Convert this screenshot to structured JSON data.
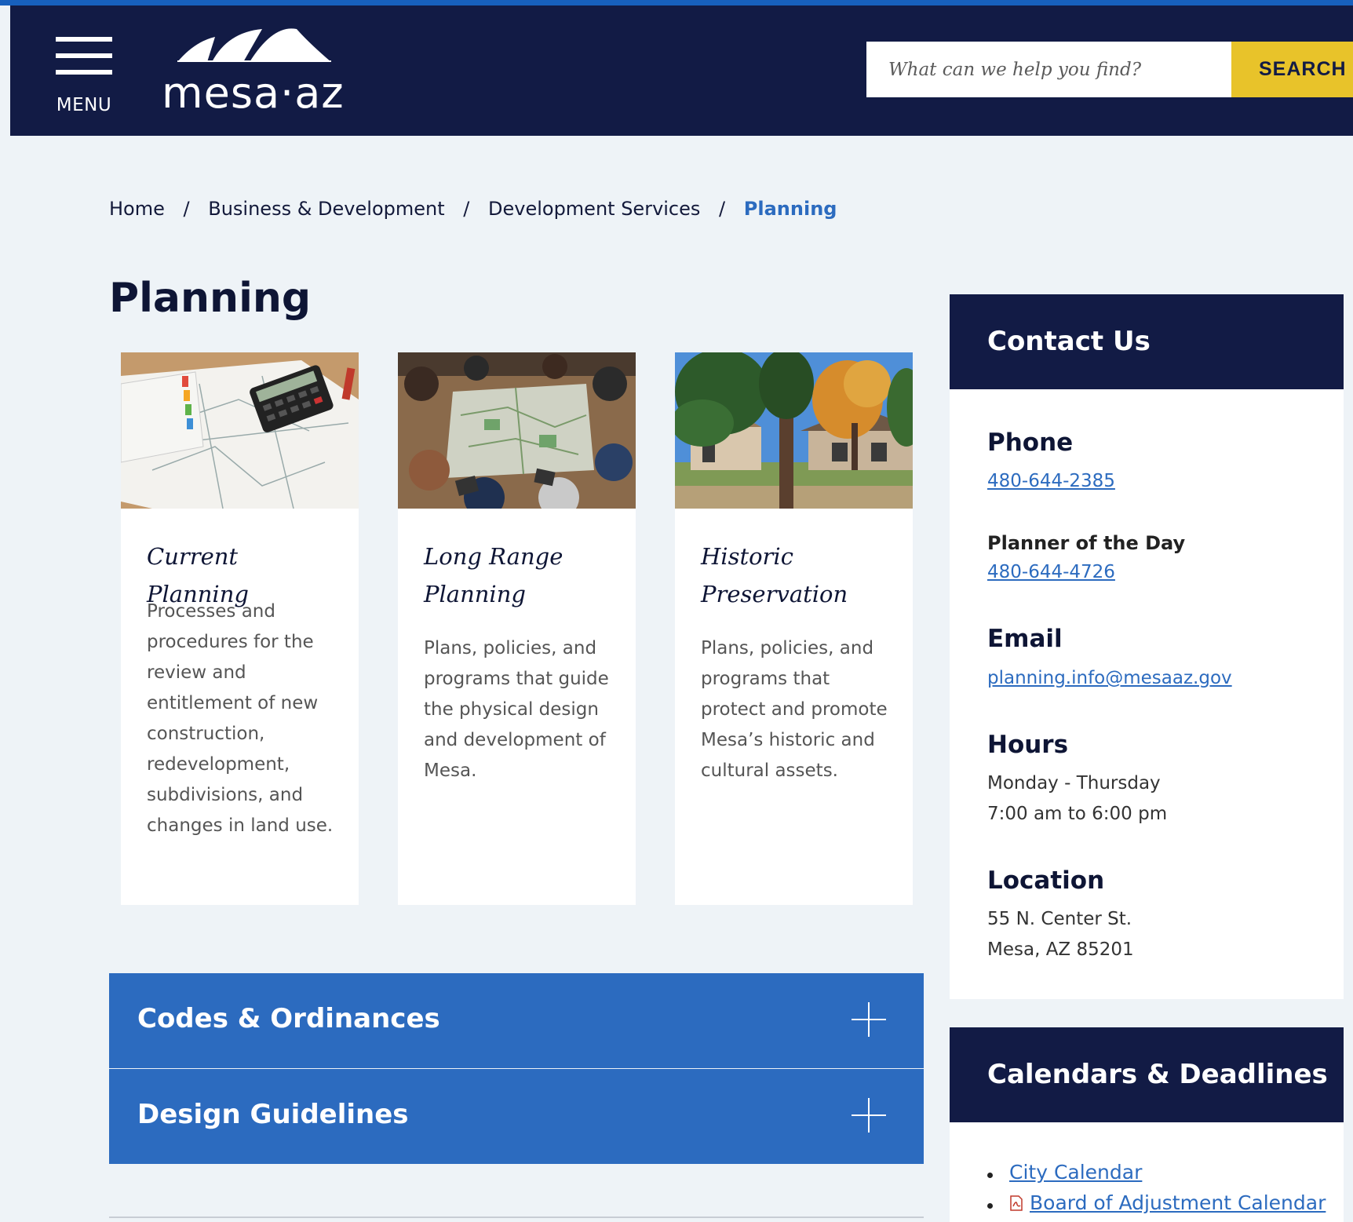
{
  "header": {
    "menu_label": "MENU",
    "logo_text": "mesa·az",
    "search": {
      "placeholder": "What can we help you find?",
      "button_label": "SEARCH"
    }
  },
  "breadcrumb": [
    {
      "label": "Home"
    },
    {
      "label": "Business & Development"
    },
    {
      "label": "Development Services"
    },
    {
      "label": "Planning"
    }
  ],
  "breadcrumb_separator": "/",
  "page_title": "Planning",
  "cards": [
    {
      "title": "Current Planning",
      "description": "Processes and procedures for the review and entitlement of new construction, redevelopment, subdivisions, and changes in land use."
    },
    {
      "title": "Long Range Planning",
      "description": "Plans, policies, and programs that guide the physical design and development of Mesa."
    },
    {
      "title": "Historic Preservation",
      "description": "Plans, policies, and programs that protect and promote Mesa’s historic and cultural assets."
    }
  ],
  "accordions": [
    {
      "title": "Codes & Ordinances"
    },
    {
      "title": "Design Guidelines"
    }
  ],
  "contact": {
    "heading": "Contact Us",
    "phone_label": "Phone",
    "phone": "480-644-2385",
    "planner_label": "Planner of the Day",
    "planner_phone": "480-644-4726",
    "email_label": "Email",
    "email": "planning.info@mesaaz.gov",
    "hours_label": "Hours",
    "hours_days": "Monday - Thursday",
    "hours_time": "7:00 am to 6:00 pm",
    "location_label": "Location",
    "address_line1": "55 N. Center St.",
    "address_line2": "Mesa, AZ 85201"
  },
  "calendars": {
    "heading": "Calendars & Deadlines",
    "items": [
      {
        "label": "City Calendar",
        "icon": ""
      },
      {
        "label": "Board of Adjustment Calendar",
        "icon": "pdf-icon"
      }
    ]
  },
  "colors": {
    "navy": "#121b45",
    "blue": "#2c6bbf",
    "yellow": "#e8c32a",
    "page_bg": "#eef3f7"
  }
}
